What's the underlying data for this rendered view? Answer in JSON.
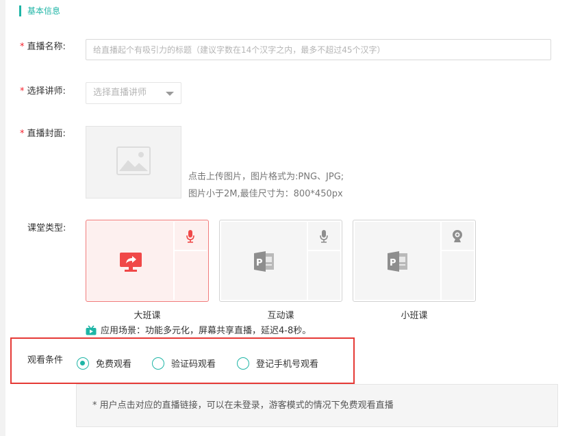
{
  "section": {
    "title": "基本信息"
  },
  "fields": {
    "live_name": {
      "required_mark": "*",
      "label": "直播名称:",
      "placeholder": "给直播起个有吸引力的标题（建议字数在14个汉字之内，最多不超过45个汉字）",
      "value": ""
    },
    "teacher": {
      "required_mark": "*",
      "label": "选择讲师:",
      "placeholder": "选择直播讲师"
    },
    "cover": {
      "required_mark": "*",
      "label": "直播封面:",
      "hint_line1": "点击上传图片，图片格式为:PNG、JPG;",
      "hint_line2": "图片小于2M,最佳尺寸为：800*450px"
    },
    "class_type": {
      "label": "课堂类型:",
      "options": [
        {
          "name": "大班课",
          "selected": true,
          "main_icon": "screen-share-icon",
          "side_icon": "microphone-icon"
        },
        {
          "name": "互动课",
          "selected": false,
          "main_icon": "powerpoint-icon",
          "side_icon": "microphone-icon"
        },
        {
          "name": "小班课",
          "selected": false,
          "main_icon": "powerpoint-icon",
          "side_icon": "webcam-icon"
        }
      ],
      "scene": "应用场景：功能多元化，屏幕共享直播，延迟4-8秒。"
    },
    "watch_condition": {
      "label": "观看条件",
      "options": [
        {
          "label": "免费观看",
          "selected": true
        },
        {
          "label": "验证码观看",
          "selected": false
        },
        {
          "label": "登记手机号观看",
          "selected": false
        }
      ],
      "notice": "* 用户点击对应的直播链接，可以在未登录，游客模式的情况下免费观看直播"
    }
  },
  "colors": {
    "accent": "#1fb5a6",
    "required": "#f5222d",
    "highlight_box": "#e53935",
    "selected_card_icon": "#f04848",
    "unselected_card_icon": "#8e8e8e"
  }
}
